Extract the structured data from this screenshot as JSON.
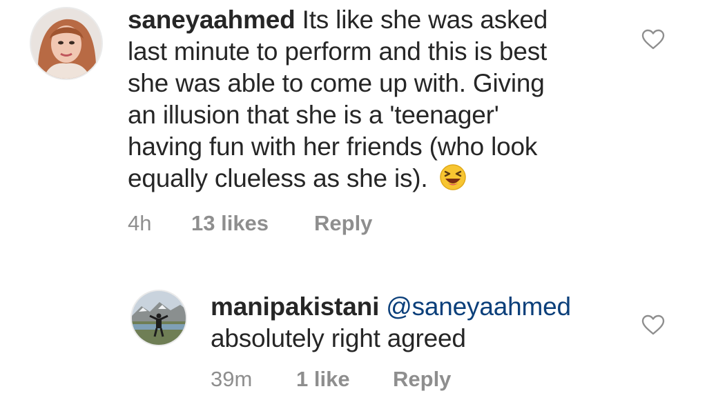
{
  "comments": [
    {
      "username": "saneyaahmed",
      "text_lines": [
        "Its like she was asked",
        "last minute to perform and this is best",
        "she was able to come up with. Giving",
        "an illusion that she is a 'teenager'",
        "having fun with her friends (who look",
        "equally clueless as she is)."
      ],
      "emoji_icon": "laughing-squint-emoji",
      "time": "4h",
      "likes": "13 likes",
      "reply_label": "Reply"
    },
    {
      "username": "manipakistani",
      "mention": "@saneyaahmed",
      "text_line2": "absolutely right agreed",
      "time": "39m",
      "likes": "1 like",
      "reply_label": "Reply"
    }
  ],
  "colors": {
    "text": "#262626",
    "meta": "#8e8e8e",
    "mention": "#0b3f7a",
    "background": "#ffffff"
  }
}
